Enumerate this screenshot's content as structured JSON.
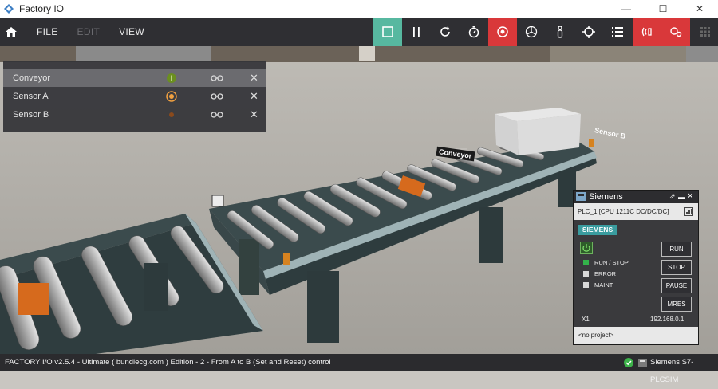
{
  "window": {
    "title": "Factory IO",
    "minimize": "—",
    "maximize": "☐",
    "close": "✕"
  },
  "menu": {
    "file": "FILE",
    "edit": "EDIT",
    "view": "VIEW"
  },
  "toolbar_icons": [
    "stop-square-icon",
    "pause-icon",
    "reset-icon",
    "timer-icon",
    "camera-fly-icon",
    "fan-icon",
    "first-person-icon",
    "crosshair-icon",
    "list-icon",
    "sensor-icon",
    "drivers-icon",
    "grid-icon"
  ],
  "colors": {
    "accent_green": "#57b8a0",
    "accent_red": "#d9383a",
    "menubar": "#2f2f33"
  },
  "tags_panel": {
    "rows": [
      {
        "label": "Conveyor",
        "state": "on"
      },
      {
        "label": "Sensor A",
        "state": "active"
      },
      {
        "label": "Sensor B",
        "state": "off"
      }
    ]
  },
  "scene_labels": {
    "conveyor": "Conveyor",
    "sensor_b": "Sensor B"
  },
  "plc": {
    "title": "Siemens",
    "cpu": "PLC_1 [CPU 1211C DC/DC/DC]",
    "brand": "SIEMENS",
    "buttons": {
      "run": "RUN",
      "stop": "STOP",
      "pause": "PAUSE",
      "mres": "MRES"
    },
    "leds": [
      {
        "label": "RUN / STOP",
        "on": true
      },
      {
        "label": "ERROR",
        "on": false
      },
      {
        "label": "MAINT",
        "on": false
      }
    ],
    "port": "X1",
    "ip": "192.168.0.1",
    "project": "<no project>"
  },
  "status": {
    "text": "FACTORY I/O v2.5.4 - Ultimate ( bundlecg.com ) Edition - 2 - From A to B (Set and Reset) control",
    "driver": "Siemens S7-PLCSIM"
  }
}
